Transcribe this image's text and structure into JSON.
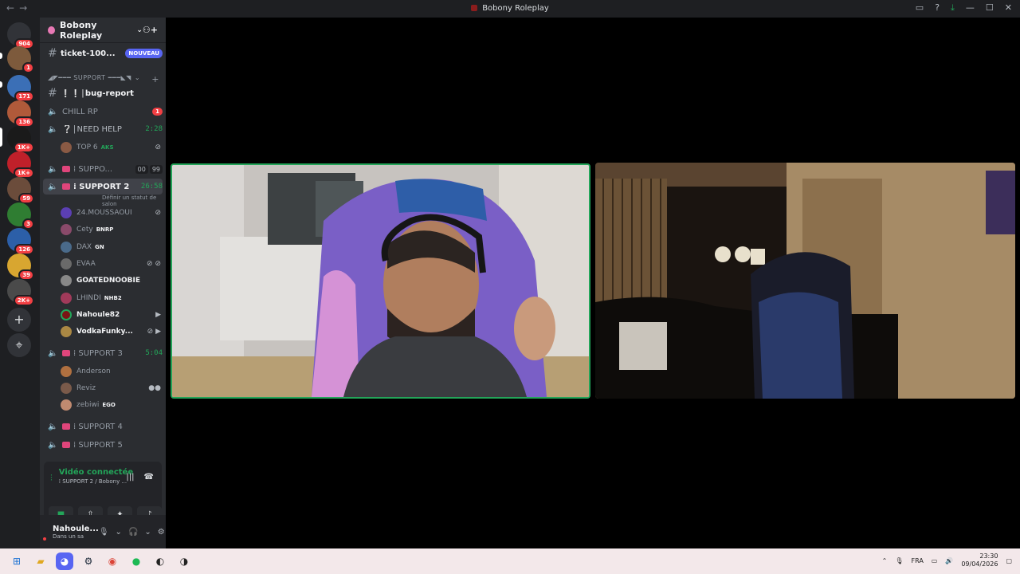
{
  "window": {
    "title": "Bobony Roleplay",
    "back": "←",
    "forward": "→"
  },
  "titlebar_icons": [
    "inbox-icon",
    "help-icon",
    "download-icon",
    "minimize-icon",
    "maximize-icon",
    "close-icon"
  ],
  "rail": {
    "servers": [
      {
        "badge": "904",
        "color": "#5865f2"
      },
      {
        "badge": "1",
        "color": "#7d5a3c"
      },
      {
        "badge": "171",
        "color": "#3b6fb6"
      },
      {
        "badge": "136",
        "color": "#b05a3a"
      },
      {
        "badge": "1K+",
        "color": "#1a1a1a"
      },
      {
        "badge": "1K+",
        "color": "#c0202a"
      },
      {
        "badge": "59",
        "color": "#6b4c3b"
      },
      {
        "badge": "3",
        "color": "#2f7d32"
      },
      {
        "badge": "126",
        "color": "#2c5fa8"
      },
      {
        "badge": "39",
        "color": "#d8a630"
      },
      {
        "badge": "2K+",
        "color": "#4a4a4a"
      }
    ]
  },
  "sidebar": {
    "server_name": "Bobony Roleplay",
    "ticket": {
      "name": "ticket-100...",
      "badge": "NOUVEAU"
    },
    "category": "◢◤━━━ SUPPORT ━━━◣◥",
    "bug_report": "❕❕│bug-report",
    "chill_rp": {
      "name": "CHILL RP",
      "badge": "1"
    },
    "need_help": {
      "name": "❔│NEED HELP",
      "timer": "2:28"
    },
    "need_help_users": [
      {
        "name": "TOP 6",
        "tag": "AKS",
        "color": "#8a5a44"
      }
    ],
    "support1": {
      "name": "⁞ SUPPO...",
      "count": "00",
      "limit": "99"
    },
    "support2": {
      "name": "⁞ SUPPORT 2",
      "timer": "26:58",
      "status": "Définir un statut de salon"
    },
    "support2_users": [
      {
        "name": "24.MOUSSAOUI",
        "tag": "",
        "color": "#5b3fb3"
      },
      {
        "name": "Cety",
        "tag": "BNRP",
        "color": "#8a4a6a"
      },
      {
        "name": "DAX",
        "tag": "GN",
        "color": "#4a6a8a"
      },
      {
        "name": "EVAA",
        "tag": "",
        "color": "#6a6a6a"
      },
      {
        "name": "GOATEDNOOBIE",
        "tag": "",
        "color": "#888888"
      },
      {
        "name": "LHINDI",
        "tag": "NHB2",
        "color": "#a03a5a"
      },
      {
        "name": "Nahoule82",
        "tag": "",
        "color": "#7a1414"
      },
      {
        "name": "VodkaFunky...",
        "tag": "",
        "color": "#aa8844"
      }
    ],
    "support3": {
      "name": "⁞ SUPPORT 3",
      "timer": "5:04"
    },
    "support3_users": [
      {
        "name": "Anderson",
        "tag": "",
        "color": "#b07040"
      },
      {
        "name": "Reviz",
        "tag": "",
        "color": "#7a5a4a"
      },
      {
        "name": "zebiwi",
        "tag": "EGO",
        "color": "#c08a70"
      }
    ],
    "support4": "⁞ SUPPORT 4",
    "support5": "⁞ SUPPORT 5"
  },
  "voice": {
    "status": "Vidéo connectée",
    "channel": "⁞ SUPPORT 2 / Bobony ...",
    "buttons": [
      "camera-icon",
      "screen-share-icon",
      "activities-icon",
      "soundboard-icon"
    ]
  },
  "user_panel": {
    "name": "Nahoule...",
    "status": "Dans un sa"
  },
  "taskbar": {
    "lang": "FRA",
    "time": "23:30",
    "date": "09/04/2026"
  }
}
